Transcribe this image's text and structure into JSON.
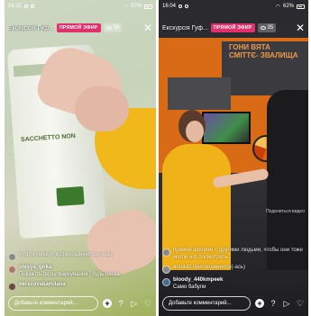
{
  "left": {
    "status_time": "16:22",
    "battery": "57%",
    "account_name": "Екскурсія Гуф...",
    "live_label": "ПРЯМОЙ ЭФИР",
    "viewer_count": "36",
    "bag_text": "SACCHETTO NON",
    "comments": [
      {
        "user": "",
        "text": "vyshnyvetskyi_a присоединился(-ась)",
        "system": true
      },
      {
        "user": "olesya_girka",
        "text": "Покажіть де це маркування , будь ласка",
        "system": false
      },
      {
        "user": "berezovskamilana",
        "text": "",
        "system": false
      }
    ],
    "comment_placeholder": "Добавьте комментарий..."
  },
  "right": {
    "status_time": "16:04",
    "battery": "62%",
    "account_name": "Екскурсія Гуф...",
    "live_label": "ПРЯМОЙ ЭФИР",
    "viewer_count": "35",
    "exhibit_title": "ГОНИ ВЯТА СМІТТЄ- ЗВАЛИЩА",
    "share_caption": "Поделиться видео",
    "comments": [
      {
        "user": "",
        "text": "прямой эфиром с другими людьми, чтобы они тоже могли его посмотреть.",
        "system": true
      },
      {
        "user": "",
        "text": "adriad0 присоединился(-ась)",
        "system": true
      },
      {
        "user": "bloody_440kmpeek",
        "text": "Само бабули",
        "system": false
      }
    ],
    "comment_placeholder": "Добавьте комментарий..."
  },
  "icons": {
    "add": "+",
    "question": "?",
    "send": "▷",
    "heart": "♡",
    "close": "✕"
  },
  "colors": {
    "live_badge": "#e1306c",
    "sweater": "#efb319",
    "exhibit_orange": "#d96a16"
  }
}
